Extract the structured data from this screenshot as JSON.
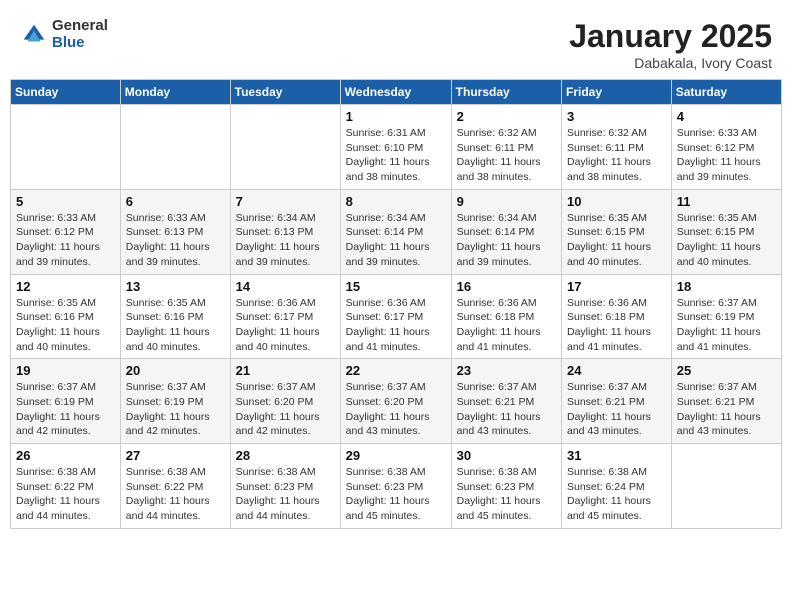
{
  "logo": {
    "general": "General",
    "blue": "Blue"
  },
  "title": "January 2025",
  "subtitle": "Dabakala, Ivory Coast",
  "days_header": [
    "Sunday",
    "Monday",
    "Tuesday",
    "Wednesday",
    "Thursday",
    "Friday",
    "Saturday"
  ],
  "weeks": [
    [
      {
        "day": "",
        "info": ""
      },
      {
        "day": "",
        "info": ""
      },
      {
        "day": "",
        "info": ""
      },
      {
        "day": "1",
        "info": "Sunrise: 6:31 AM\nSunset: 6:10 PM\nDaylight: 11 hours\nand 38 minutes."
      },
      {
        "day": "2",
        "info": "Sunrise: 6:32 AM\nSunset: 6:11 PM\nDaylight: 11 hours\nand 38 minutes."
      },
      {
        "day": "3",
        "info": "Sunrise: 6:32 AM\nSunset: 6:11 PM\nDaylight: 11 hours\nand 38 minutes."
      },
      {
        "day": "4",
        "info": "Sunrise: 6:33 AM\nSunset: 6:12 PM\nDaylight: 11 hours\nand 39 minutes."
      }
    ],
    [
      {
        "day": "5",
        "info": "Sunrise: 6:33 AM\nSunset: 6:12 PM\nDaylight: 11 hours\nand 39 minutes."
      },
      {
        "day": "6",
        "info": "Sunrise: 6:33 AM\nSunset: 6:13 PM\nDaylight: 11 hours\nand 39 minutes."
      },
      {
        "day": "7",
        "info": "Sunrise: 6:34 AM\nSunset: 6:13 PM\nDaylight: 11 hours\nand 39 minutes."
      },
      {
        "day": "8",
        "info": "Sunrise: 6:34 AM\nSunset: 6:14 PM\nDaylight: 11 hours\nand 39 minutes."
      },
      {
        "day": "9",
        "info": "Sunrise: 6:34 AM\nSunset: 6:14 PM\nDaylight: 11 hours\nand 39 minutes."
      },
      {
        "day": "10",
        "info": "Sunrise: 6:35 AM\nSunset: 6:15 PM\nDaylight: 11 hours\nand 40 minutes."
      },
      {
        "day": "11",
        "info": "Sunrise: 6:35 AM\nSunset: 6:15 PM\nDaylight: 11 hours\nand 40 minutes."
      }
    ],
    [
      {
        "day": "12",
        "info": "Sunrise: 6:35 AM\nSunset: 6:16 PM\nDaylight: 11 hours\nand 40 minutes."
      },
      {
        "day": "13",
        "info": "Sunrise: 6:35 AM\nSunset: 6:16 PM\nDaylight: 11 hours\nand 40 minutes."
      },
      {
        "day": "14",
        "info": "Sunrise: 6:36 AM\nSunset: 6:17 PM\nDaylight: 11 hours\nand 40 minutes."
      },
      {
        "day": "15",
        "info": "Sunrise: 6:36 AM\nSunset: 6:17 PM\nDaylight: 11 hours\nand 41 minutes."
      },
      {
        "day": "16",
        "info": "Sunrise: 6:36 AM\nSunset: 6:18 PM\nDaylight: 11 hours\nand 41 minutes."
      },
      {
        "day": "17",
        "info": "Sunrise: 6:36 AM\nSunset: 6:18 PM\nDaylight: 11 hours\nand 41 minutes."
      },
      {
        "day": "18",
        "info": "Sunrise: 6:37 AM\nSunset: 6:19 PM\nDaylight: 11 hours\nand 41 minutes."
      }
    ],
    [
      {
        "day": "19",
        "info": "Sunrise: 6:37 AM\nSunset: 6:19 PM\nDaylight: 11 hours\nand 42 minutes."
      },
      {
        "day": "20",
        "info": "Sunrise: 6:37 AM\nSunset: 6:19 PM\nDaylight: 11 hours\nand 42 minutes."
      },
      {
        "day": "21",
        "info": "Sunrise: 6:37 AM\nSunset: 6:20 PM\nDaylight: 11 hours\nand 42 minutes."
      },
      {
        "day": "22",
        "info": "Sunrise: 6:37 AM\nSunset: 6:20 PM\nDaylight: 11 hours\nand 43 minutes."
      },
      {
        "day": "23",
        "info": "Sunrise: 6:37 AM\nSunset: 6:21 PM\nDaylight: 11 hours\nand 43 minutes."
      },
      {
        "day": "24",
        "info": "Sunrise: 6:37 AM\nSunset: 6:21 PM\nDaylight: 11 hours\nand 43 minutes."
      },
      {
        "day": "25",
        "info": "Sunrise: 6:37 AM\nSunset: 6:21 PM\nDaylight: 11 hours\nand 43 minutes."
      }
    ],
    [
      {
        "day": "26",
        "info": "Sunrise: 6:38 AM\nSunset: 6:22 PM\nDaylight: 11 hours\nand 44 minutes."
      },
      {
        "day": "27",
        "info": "Sunrise: 6:38 AM\nSunset: 6:22 PM\nDaylight: 11 hours\nand 44 minutes."
      },
      {
        "day": "28",
        "info": "Sunrise: 6:38 AM\nSunset: 6:23 PM\nDaylight: 11 hours\nand 44 minutes."
      },
      {
        "day": "29",
        "info": "Sunrise: 6:38 AM\nSunset: 6:23 PM\nDaylight: 11 hours\nand 45 minutes."
      },
      {
        "day": "30",
        "info": "Sunrise: 6:38 AM\nSunset: 6:23 PM\nDaylight: 11 hours\nand 45 minutes."
      },
      {
        "day": "31",
        "info": "Sunrise: 6:38 AM\nSunset: 6:24 PM\nDaylight: 11 hours\nand 45 minutes."
      },
      {
        "day": "",
        "info": ""
      }
    ]
  ]
}
